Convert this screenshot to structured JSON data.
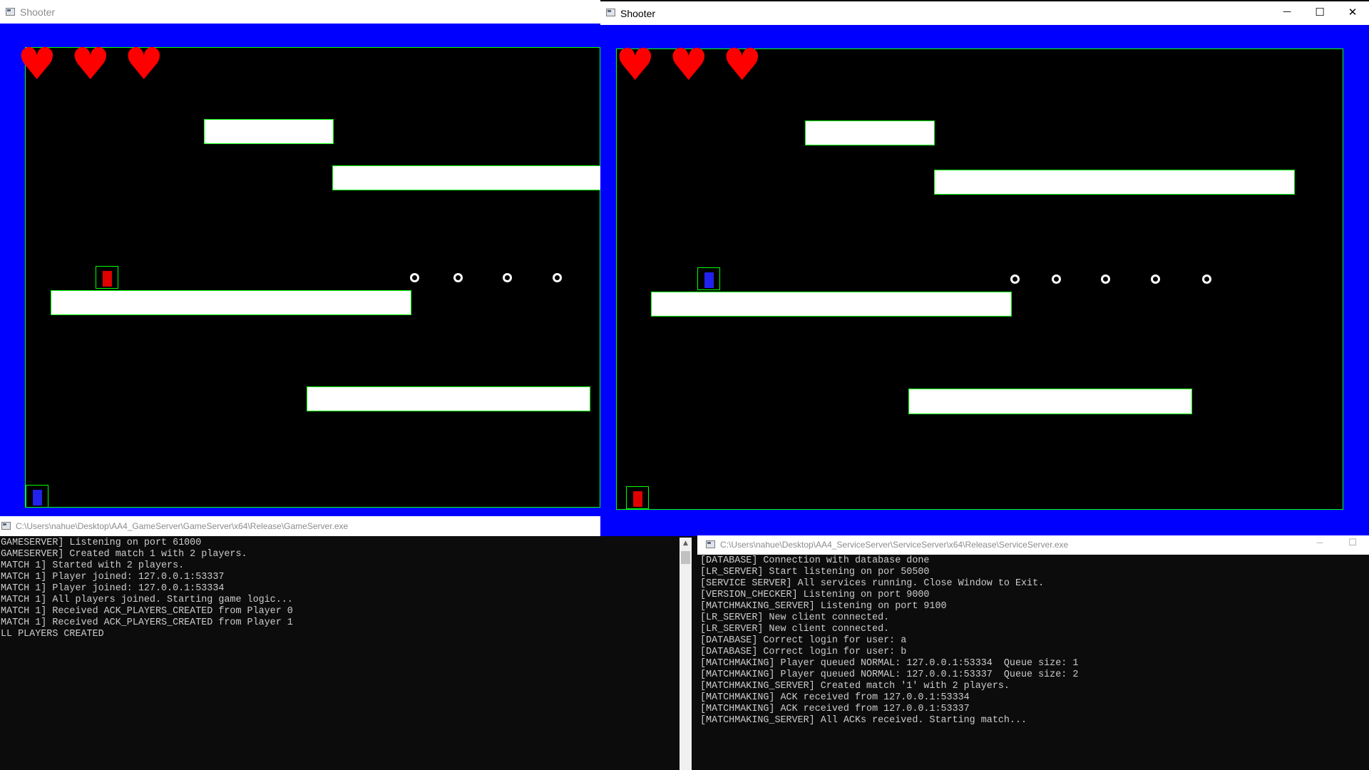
{
  "shooter_left": {
    "title": "Shooter",
    "hearts": [
      "♥",
      "♥",
      "♥"
    ]
  },
  "shooter_right": {
    "title": "Shooter",
    "hearts": [
      "♥",
      "♥",
      "♥"
    ],
    "controls": {
      "minimize": "—",
      "maximize": "☐",
      "close": "✕"
    }
  },
  "gameserver_console": {
    "title": "C:\\Users\\nahue\\Desktop\\AA4_GameServer\\GameServer\\x64\\Release\\GameServer.exe",
    "lines": [
      "GAMESERVER] Listening on port 61000",
      "GAMESERVER] Created match 1 with 2 players.",
      "MATCH 1] Started with 2 players.",
      "MATCH 1] Player joined: 127.0.0.1:53337",
      "MATCH 1] Player joined: 127.0.0.1:53334",
      "MATCH 1] All players joined. Starting game logic...",
      "MATCH 1] Received ACK_PLAYERS_CREATED from Player 0",
      "MATCH 1] Received ACK_PLAYERS_CREATED from Player 1",
      "LL PLAYERS CREATED"
    ]
  },
  "serviceserver_console": {
    "title": "C:\\Users\\nahue\\Desktop\\AA4_ServiceServer\\ServiceServer\\x64\\Release\\ServiceServer.exe",
    "controls": {
      "minimize": "—",
      "maximize": "☐"
    },
    "lines": [
      "[DATABASE] Connection with database done",
      "[LR_SERVER] Start listening on por 50500",
      "[SERVICE SERVER] All services running. Close Window to Exit.",
      "[VERSION_CHECKER] Listening on port 9000",
      "[MATCHMAKING_SERVER] Listening on port 9100",
      "[LR_SERVER] New client connected.",
      "[LR_SERVER] New client connected.",
      "[DATABASE] Correct login for user: a",
      "[DATABASE] Correct login for user: b",
      "[MATCHMAKING] Player queued NORMAL: 127.0.0.1:53334  Queue size: 1",
      "[MATCHMAKING] Player queued NORMAL: 127.0.0.1:53337  Queue size: 2",
      "[MATCHMAKING_SERVER] Created match '1' with 2 players.",
      "[MATCHMAKING] ACK received from 127.0.0.1:53334",
      "[MATCHMAKING] ACK received from 127.0.0.1:53337",
      "[MATCHMAKING_SERVER] All ACKs received. Starting match..."
    ]
  },
  "colors": {
    "blue_border": "#0000ff",
    "arena_bg": "#000000",
    "outline": "#00ff00",
    "heart": "#ff0000",
    "platform": "#ffffff",
    "console_bg": "#0c0c0c",
    "console_text": "#cccccc"
  }
}
